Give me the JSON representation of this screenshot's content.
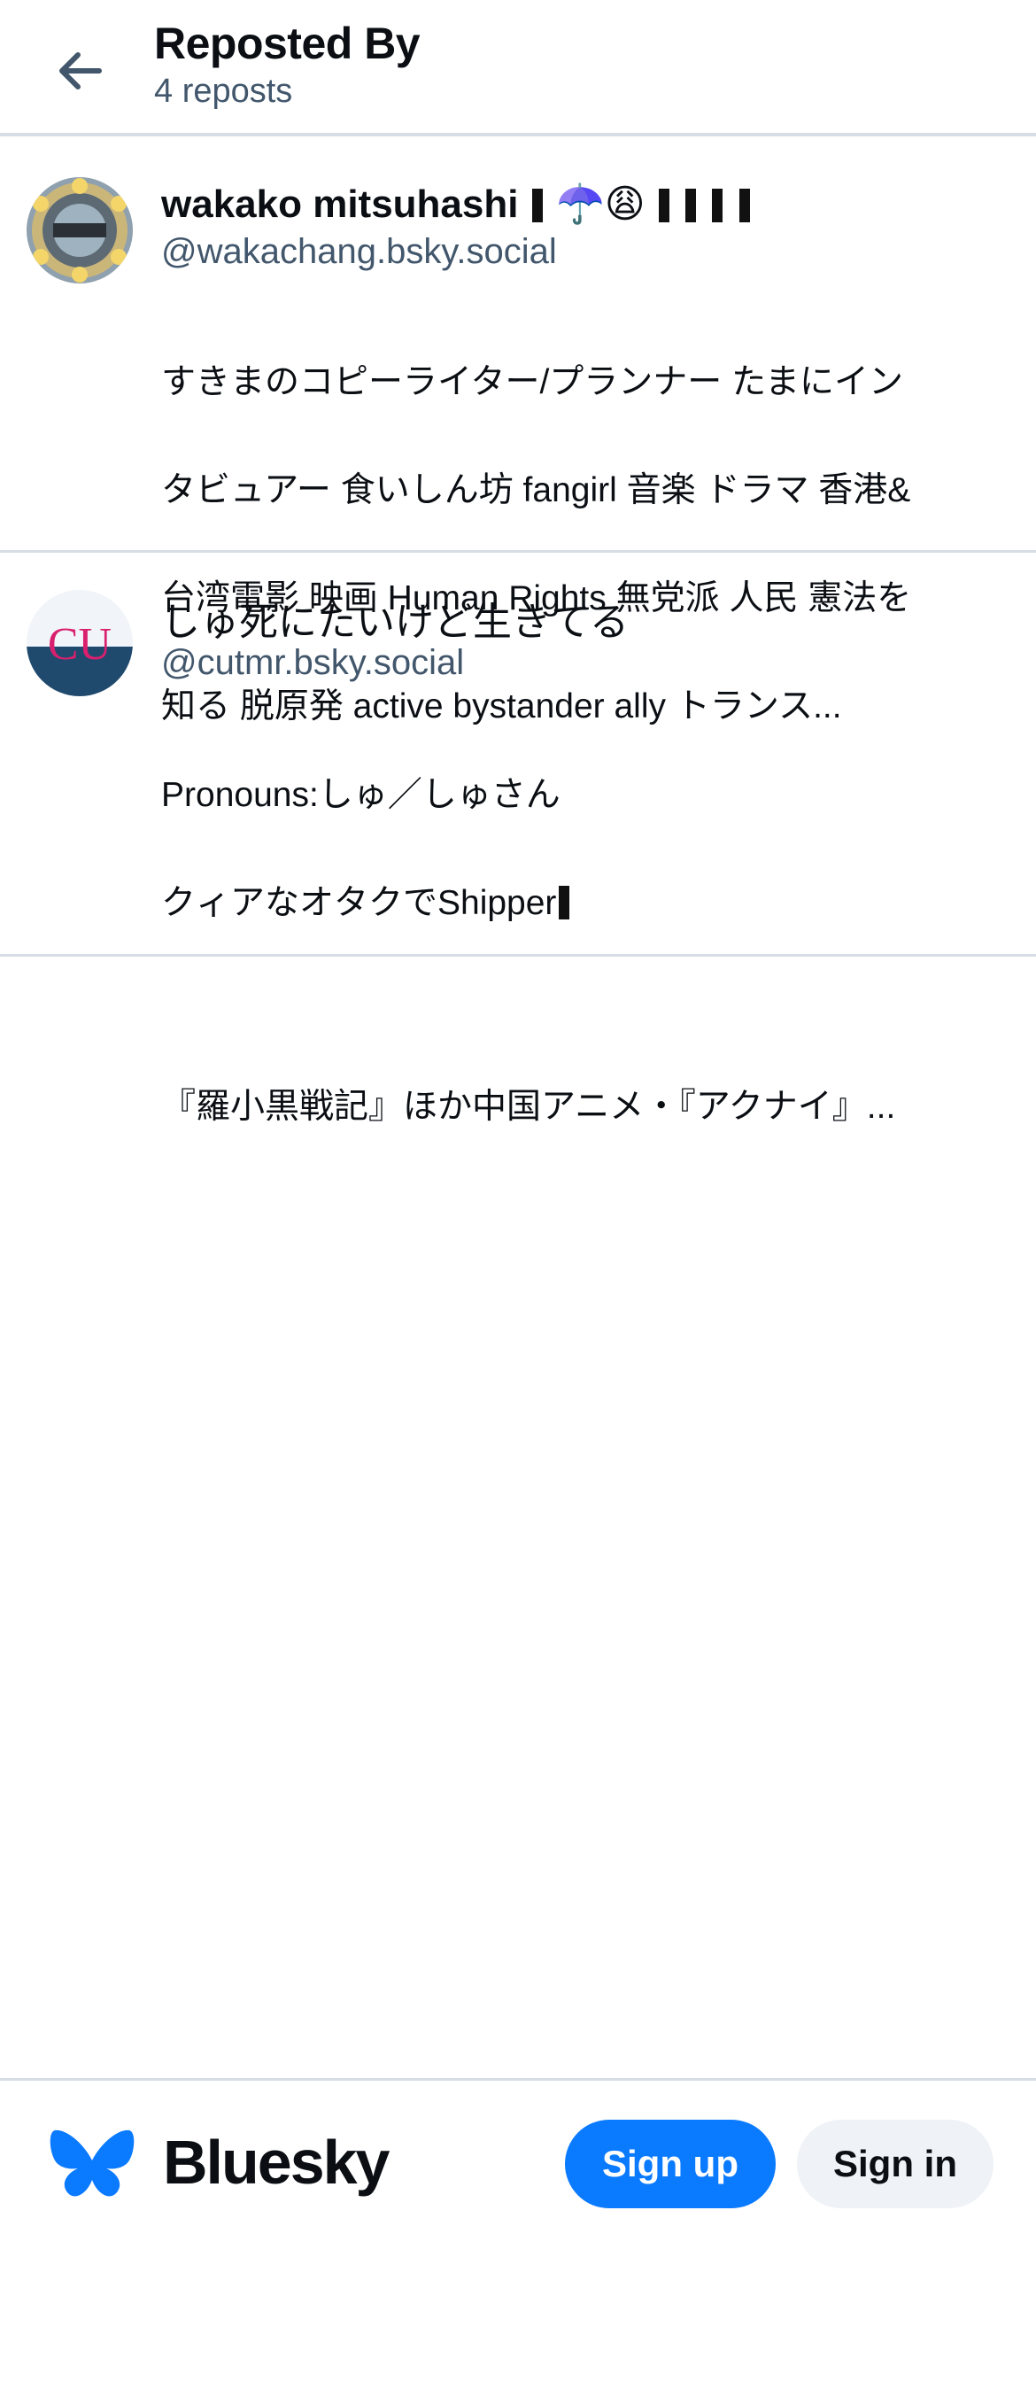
{
  "header": {
    "title": "Reposted By",
    "subtitle": "4 reposts",
    "back_icon": "arrow-left-icon"
  },
  "users": [
    {
      "display_name": "wakako mitsuhashi",
      "name_suffix": "☂️😩",
      "handle": "@wakachang.bsky.social",
      "bio_lines": [
        "すきまのコピーライター/プランナー たまにイン",
        "タビュアー 食いしん坊 fangirl 音楽 ドラマ 香港&",
        "台湾電影 映画 Human Rights 無党派 人民 憲法を",
        "知る 脱原発 active bystander ally トランス..."
      ]
    },
    {
      "display_name": "しゅ死にたいけど生きてる",
      "handle": "@cutmr.bsky.social",
      "bio_lines": [
        "Pronouns:しゅ／しゅさん",
        "クィアなオタクでShipper",
        "",
        "『羅小黒戦記』ほか中国アニメ・『アクナイ』..."
      ]
    }
  ],
  "footer": {
    "brand": "Bluesky",
    "logo_icon": "butterfly-icon",
    "signup_label": "Sign up",
    "signin_label": "Sign in",
    "accent": "#0a7aff"
  }
}
